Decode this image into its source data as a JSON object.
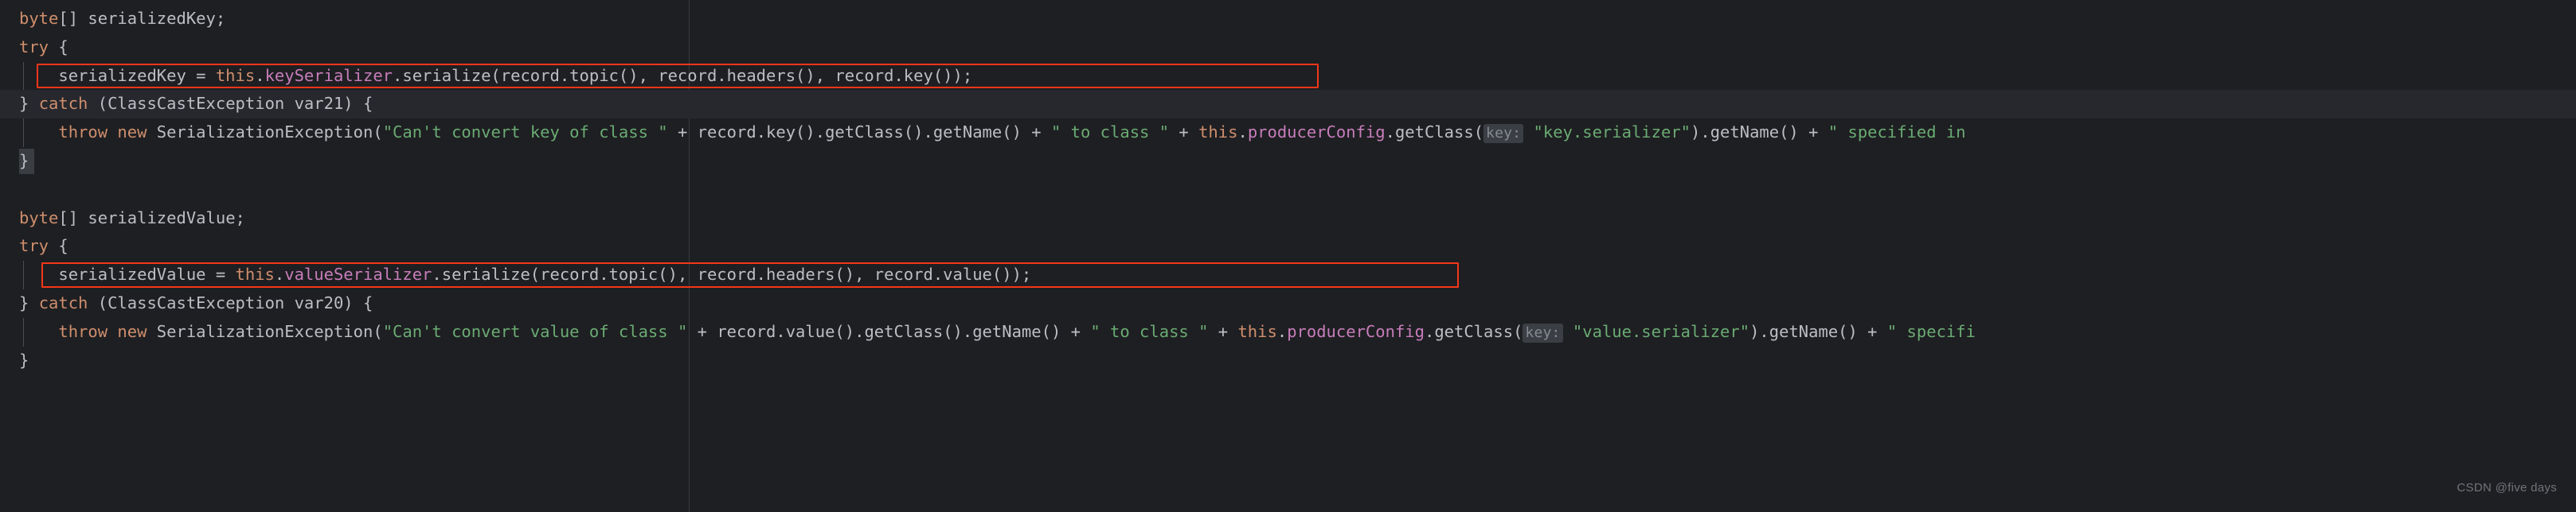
{
  "editor": {
    "theme_background": "#1e1f22",
    "default_text_color": "#bcbec4",
    "keyword_color": "#cf8e6d",
    "string_color": "#6aab73",
    "field_color": "#c77dbb",
    "annotation_box_color": "#f4361a",
    "caret_line_color": "#26282e",
    "indent_guide_color": "#4a4d52",
    "margin_rule_color": "#393b40"
  },
  "watermark": {
    "text": "CSDN @five days"
  },
  "lines": [
    {
      "id": "line-1",
      "text": "byte[] serializedKey;",
      "tokens": [
        {
          "t": "byte",
          "c": "kw"
        },
        {
          "t": "[] ",
          "c": "plain"
        },
        {
          "t": "serializedKey;",
          "c": "plain"
        }
      ]
    },
    {
      "id": "line-2",
      "text": "try {",
      "tokens": [
        {
          "t": "try",
          "c": "kw"
        },
        {
          "t": " {",
          "c": "plain"
        }
      ]
    },
    {
      "id": "line-3",
      "text": "    serializedKey = this.keySerializer.serialize(record.topic(), record.headers(), record.key());",
      "tokens": [
        {
          "t": "    serializedKey = ",
          "c": "plain"
        },
        {
          "t": "this",
          "c": "kw"
        },
        {
          "t": ".",
          "c": "plain"
        },
        {
          "t": "keySerializer",
          "c": "field"
        },
        {
          "t": ".serialize(record.topic(), record.headers(), record.key());",
          "c": "plain"
        }
      ]
    },
    {
      "id": "line-4",
      "text": "} catch (ClassCastException var21) {",
      "tokens": [
        {
          "t": "} ",
          "c": "plain"
        },
        {
          "t": "catch",
          "c": "kw"
        },
        {
          "t": " (ClassCastException var21) {",
          "c": "plain"
        }
      ]
    },
    {
      "id": "line-5",
      "text": "    throw new SerializationException(\"Can't convert key of class \" + record.key().getClass().getName() + \" to class \" + this.producerConfig.getClass( key: \"key.serializer\").getName() + \" specified in",
      "tokens": [
        {
          "t": "    ",
          "c": "plain"
        },
        {
          "t": "throw new",
          "c": "kw"
        },
        {
          "t": " SerializationException(",
          "c": "plain"
        },
        {
          "t": "\"Can't convert key of class \"",
          "c": "str"
        },
        {
          "t": " + record.key().getClass().getName() + ",
          "c": "plain"
        },
        {
          "t": "\" to class \"",
          "c": "str"
        },
        {
          "t": " + ",
          "c": "plain"
        },
        {
          "t": "this",
          "c": "kw"
        },
        {
          "t": ".",
          "c": "plain"
        },
        {
          "t": "producerConfig",
          "c": "field"
        },
        {
          "t": ".getClass(",
          "c": "plain"
        },
        {
          "t": "key:",
          "c": "inlay"
        },
        {
          "t": " ",
          "c": "plain"
        },
        {
          "t": "\"key.serializer\"",
          "c": "str"
        },
        {
          "t": ").getName() + ",
          "c": "plain"
        },
        {
          "t": "\" specified in",
          "c": "str"
        }
      ]
    },
    {
      "id": "line-6",
      "text": "}",
      "tokens": [
        {
          "t": "}",
          "c": "plain"
        }
      ]
    },
    {
      "id": "line-7",
      "text": "",
      "tokens": []
    },
    {
      "id": "line-8",
      "text": "byte[] serializedValue;",
      "tokens": [
        {
          "t": "byte",
          "c": "kw"
        },
        {
          "t": "[] ",
          "c": "plain"
        },
        {
          "t": "serializedValue;",
          "c": "plain"
        }
      ]
    },
    {
      "id": "line-9",
      "text": "try {",
      "tokens": [
        {
          "t": "try",
          "c": "kw"
        },
        {
          "t": " {",
          "c": "plain"
        }
      ]
    },
    {
      "id": "line-10",
      "text": "    serializedValue = this.valueSerializer.serialize(record.topic(), record.headers(), record.value());",
      "tokens": [
        {
          "t": "    serializedValue = ",
          "c": "plain"
        },
        {
          "t": "this",
          "c": "kw"
        },
        {
          "t": ".",
          "c": "plain"
        },
        {
          "t": "valueSerializer",
          "c": "field"
        },
        {
          "t": ".serialize(record.topic(), record.headers(), record.value());",
          "c": "plain"
        }
      ]
    },
    {
      "id": "line-11",
      "text": "} catch (ClassCastException var20) {",
      "tokens": [
        {
          "t": "} ",
          "c": "plain"
        },
        {
          "t": "catch",
          "c": "kw"
        },
        {
          "t": " (ClassCastException var20) {",
          "c": "plain"
        }
      ]
    },
    {
      "id": "line-12",
      "text": "    throw new SerializationException(\"Can't convert value of class \" + record.value().getClass().getName() + \" to class \" + this.producerConfig.getClass( key: \"value.serializer\").getName() + \" specifi",
      "tokens": [
        {
          "t": "    ",
          "c": "plain"
        },
        {
          "t": "throw new",
          "c": "kw"
        },
        {
          "t": " SerializationException(",
          "c": "plain"
        },
        {
          "t": "\"Can't convert value of class \"",
          "c": "str"
        },
        {
          "t": " + record.value().getClass().getName() + ",
          "c": "plain"
        },
        {
          "t": "\" to class \"",
          "c": "str"
        },
        {
          "t": " + ",
          "c": "plain"
        },
        {
          "t": "this",
          "c": "kw"
        },
        {
          "t": ".",
          "c": "plain"
        },
        {
          "t": "producerConfig",
          "c": "field"
        },
        {
          "t": ".getClass(",
          "c": "plain"
        },
        {
          "t": "key:",
          "c": "inlay"
        },
        {
          "t": " ",
          "c": "plain"
        },
        {
          "t": "\"value.serializer\"",
          "c": "str"
        },
        {
          "t": ").getName() + ",
          "c": "plain"
        },
        {
          "t": "\" specifi",
          "c": "str"
        }
      ]
    },
    {
      "id": "line-13",
      "text": "}",
      "tokens": [
        {
          "t": "}",
          "c": "plain"
        }
      ]
    }
  ],
  "annotations": {
    "red_boxes": [
      {
        "id": "redbox-key-serialize",
        "label": "serializedKey-assignment-highlight"
      },
      {
        "id": "redbox-value-serialize",
        "label": "serializedValue-assignment-highlight"
      }
    ]
  }
}
